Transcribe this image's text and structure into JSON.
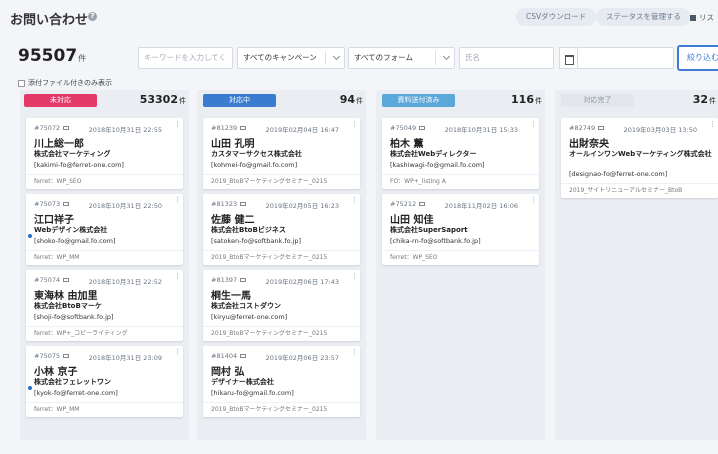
{
  "header": {
    "title": "お問い合わせ",
    "help": "?",
    "csv_label": "CSVダウンロード",
    "status_label": "ステータスを管理する",
    "list_label": "リス"
  },
  "summary": {
    "total": "95507",
    "unit": "件"
  },
  "filters": {
    "keyword_placeholder": "キーワードを入力してく",
    "campaign": "すべてのキャンペーン",
    "form": "すべてのフォーム",
    "name_placeholder": "氏名",
    "search_label": "絞り込む"
  },
  "attach_label": "添付ファイル付きのみ表示",
  "columns": [
    {
      "label": "未対応",
      "color": "#e43a6a",
      "count": "53302",
      "unit": "件"
    },
    {
      "label": "対応中",
      "color": "#3a7ccf",
      "count": "94",
      "unit": "件"
    },
    {
      "label": "資料送付済み",
      "color": "#5aa7d9",
      "count": "116",
      "unit": "件"
    },
    {
      "label": "対応完了",
      "color": "#e3e7ec",
      "count": "32",
      "unit": "件"
    }
  ],
  "cards": {
    "c0": [
      {
        "id": "#75072",
        "date": "2018年10月31日 22:55",
        "name": "川上総一郎",
        "company": "株式会社マーケティング",
        "email": "[kakimi-fo@ferret-one.com]",
        "source": "ferret：WP_SEO"
      },
      {
        "id": "#75073",
        "date": "2018年10月31日 22:50",
        "name": "江口祥子",
        "company": "Webデザイン株式会社",
        "email": "[shoko-fo@gmail.fo.com]",
        "source": "ferret：WP_MM"
      },
      {
        "id": "#75074",
        "date": "2018年10月31日 22:52",
        "name": "東海林 由加里",
        "company": "株式会社BtoBマーケ",
        "email": "[shoji-fo@softbank.fo.jp]",
        "source": "ferret：WP+_コピーライティング"
      },
      {
        "id": "#75075",
        "date": "2018年10月31日 23:09",
        "name": "小林 京子",
        "company": "株式会社フェレットワン",
        "email": "[kyok-fo@ferret-one.com]",
        "source": "ferret：WP_MM"
      }
    ],
    "c1": [
      {
        "id": "#81239",
        "date": "2019年02月04日 16:47",
        "name": "山田 孔明",
        "company": "カスタマーサクセス株式会社",
        "email": "[kohmei-fo@gmail.fo.com]",
        "source": "2019_BtoBマーケティングセミナー_0215"
      },
      {
        "id": "#81323",
        "date": "2019年02月05日 16:23",
        "name": "佐藤 健二",
        "company": "株式会社BtoBビジネス",
        "email": "[satoken-fo@softbank.fo.jp]",
        "source": "2019_BtoBマーケティングセミナー_0215"
      },
      {
        "id": "#81397",
        "date": "2019年02月06日 17:43",
        "name": "桐生一馬",
        "company": "株式会社コストダウン",
        "email": "[kiryu@ferret-one.com]",
        "source": "2019_BtoBマーケティングセミナー_0215"
      },
      {
        "id": "#81404",
        "date": "2019年02月06日 23:57",
        "name": "岡村 弘",
        "company": "デザイナー株式会社",
        "email": "[hikaru-fo@gmail.fo.com]",
        "source": "2019_BtoBマーケティングセミナー_0215"
      }
    ],
    "c2": [
      {
        "id": "#75049",
        "date": "2018年10月31日 15:33",
        "name": "柏木 薫",
        "company": "株式会社Webディレクター",
        "email": "[kashiwagi-fo@gmail.fo.com]",
        "source": "FO：WP+_listing A"
      },
      {
        "id": "#75212",
        "date": "2018年11月02日 16:06",
        "name": "山田 知佳",
        "company": "株式会社SuperSaport",
        "email": "[chika-rn-fo@softbank.fo.jp]",
        "source": "ferret：WP_SEO"
      }
    ],
    "c3": [
      {
        "id": "#82749",
        "date": "2019年03月03日 13:50",
        "name": "出財奈央",
        "company": "オールインワンWebマーケティング株式会社",
        "email": "[designao-fo@ferret-one.com]",
        "source": "2019_サイトリニューアルセミナー_BtoB"
      }
    ]
  }
}
